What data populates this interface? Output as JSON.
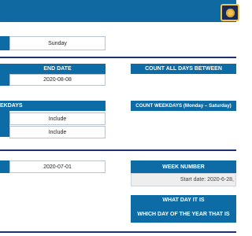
{
  "top_left": {
    "day_value": "Sunday"
  },
  "section_dates": {
    "end_date_header": "END DATE",
    "end_date_value": "2020-08-08",
    "count_all_header": "COUNT ALL DAYS BETWEEN"
  },
  "section_weekdays": {
    "weekdays_label": "EKDAYS",
    "include_1": "Include",
    "include_2": "Include",
    "count_weekdays_header": "COUNT WEEKDAYS (Monday – Saturday)"
  },
  "section_week": {
    "date_value": "2020-07-01",
    "week_number_header": "WEEK NUMBER",
    "start_date_text": "Start date: 2020-6-28,",
    "what_day_header": "WHAT DAY IT IS",
    "which_day_header": "WHICH DAY OF THE YEAR THAT IS"
  },
  "colors": {
    "accent": "#0d6ba5",
    "rule": "#1f2f76",
    "logo_gold": "#f0c44c"
  }
}
